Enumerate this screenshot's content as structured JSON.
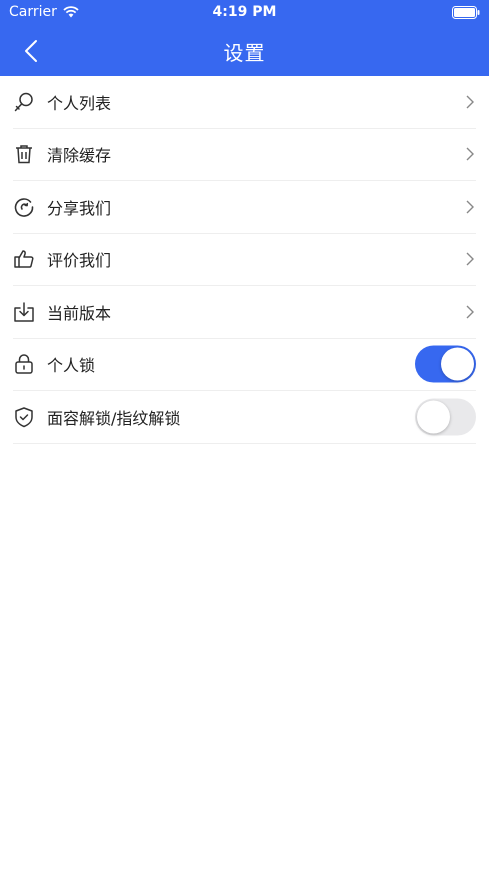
{
  "status_bar": {
    "carrier": "Carrier",
    "time": "4:19 PM"
  },
  "nav": {
    "title": "设置"
  },
  "colors": {
    "accent": "#3768f0",
    "toggle_off": "#e9e9eb"
  },
  "settings": [
    {
      "label": "个人列表",
      "icon": "search-icon",
      "control": "chevron"
    },
    {
      "label": "清除缓存",
      "icon": "trash-icon",
      "control": "chevron"
    },
    {
      "label": "分享我们",
      "icon": "share-icon",
      "control": "chevron"
    },
    {
      "label": "评价我们",
      "icon": "thumbs-up-icon",
      "control": "chevron"
    },
    {
      "label": "当前版本",
      "icon": "download-icon",
      "control": "chevron"
    },
    {
      "label": "个人锁",
      "icon": "lock-icon",
      "control": "toggle",
      "enabled": true
    },
    {
      "label": "面容解锁/指纹解锁",
      "icon": "shield-icon",
      "control": "toggle",
      "enabled": false
    }
  ]
}
